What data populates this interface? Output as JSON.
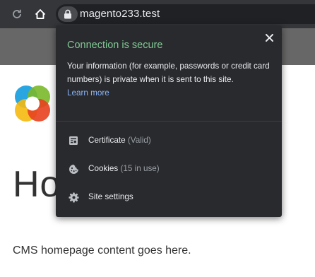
{
  "browser": {
    "url": "magento233.test"
  },
  "page": {
    "title": "Ho",
    "content": "CMS homepage content goes here."
  },
  "security_popup": {
    "title": "Connection is secure",
    "description": "Your information (for example, passwords or credit card numbers) is private when it is sent to this site.",
    "learn_more": "Learn more",
    "items": [
      {
        "label": "Certificate",
        "detail": "(Valid)",
        "icon": "certificate-icon"
      },
      {
        "label": "Cookies",
        "detail": "(15 in use)",
        "icon": "cookie-icon"
      },
      {
        "label": "Site settings",
        "detail": "",
        "icon": "gear-icon"
      }
    ]
  },
  "colors": {
    "toolbar": "#35363a",
    "popup_bg": "#292a2d",
    "secure_green": "#81c995",
    "link_blue": "#8ab4f8",
    "page_header": "#676767"
  }
}
